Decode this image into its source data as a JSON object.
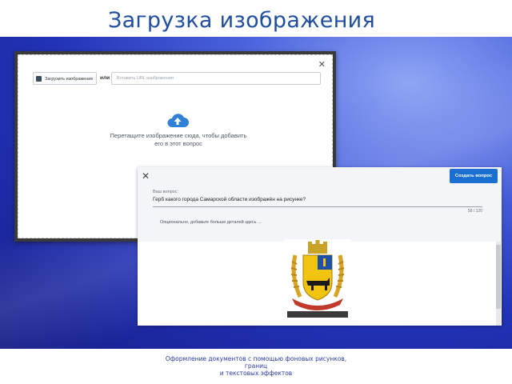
{
  "slide": {
    "title": "Загрузка изображения",
    "footer_lines": [
      "Оформление документов с помощью фоновых рисунков,",
      "границ",
      "и текстовых эффектов"
    ]
  },
  "upload_dialog": {
    "close_icon": "close-icon",
    "upload_button_label": "Загрузить изображение",
    "or_label": "или",
    "url_placeholder": "Вставить URL изображения",
    "drop_text_line1": "Перетащите изображение сюда, чтобы добавить",
    "drop_text_line2": "его в этот вопрос",
    "cloud_icon": "cloud-upload-icon",
    "accent_color": "#2f80d6"
  },
  "question_dialog": {
    "close_icon": "close-icon",
    "create_button_label": "Создать вопрос",
    "question_label": "Ваш вопрос:",
    "question_value": "Герб какого города Самарской области изображён на рисунке?",
    "char_count": "58 / 120",
    "details_placeholder": "Опционально, добавьте больше деталей здесь ...",
    "image": "coat-of-arms-image",
    "button_color": "#1a6fd1"
  }
}
